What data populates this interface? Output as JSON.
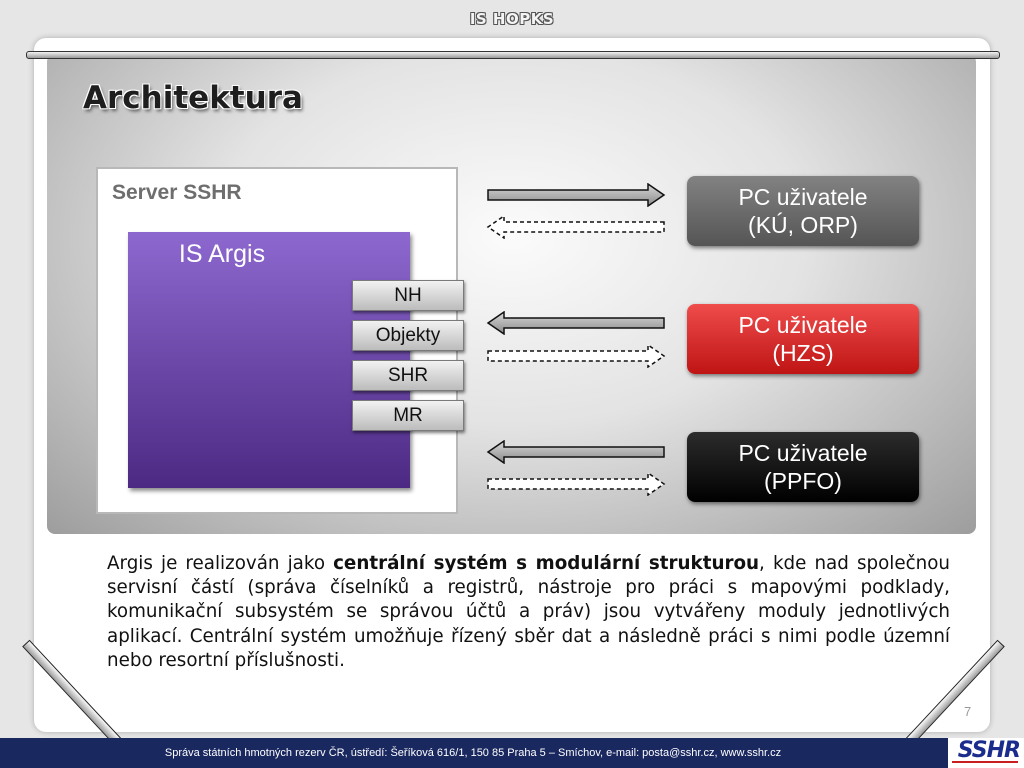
{
  "header": {
    "title": "IS HOPKS"
  },
  "slide": {
    "title": "Architektura",
    "page_number": "7"
  },
  "diagram": {
    "server_label": "Server SSHR",
    "argis_label": "IS Argis",
    "modules": [
      "NH",
      "Objekty",
      "SHR",
      "MR"
    ],
    "clients": [
      {
        "line1": "PC uživatele",
        "line2": "(KÚ, ORP)",
        "color": "#6b6b6b",
        "solid_arrow": "right"
      },
      {
        "line1": "PC uživatele",
        "line2": "(HZS)",
        "color": "#d92a2a",
        "solid_arrow": "left"
      },
      {
        "line1": "PC uživatele",
        "line2": "(PPFO)",
        "color": "#111111",
        "solid_arrow": "left"
      }
    ],
    "argis_color": "#6b46ae"
  },
  "body": {
    "pre": "Argis je realizován jako ",
    "bold": "centrální systém s modulární strukturou",
    "post": ", kde nad společnou servisní částí (správa číselníků a registrů, nástroje pro práci s mapovými podklady, komunikační subsystém se správou účtů a práv) jsou vytvářeny moduly jednotlivých aplikací. Centrální systém umožňuje řízený sběr dat a následně práci s nimi podle územní nebo resortní příslušnosti."
  },
  "footer": {
    "text": "Správa státních hmotných rezerv ČR, ústředí: Šeříková 616/1, 150 85 Praha 5 – Smíchov, e-mail: posta@sshr.cz, www.sshr.cz",
    "logo": "SSHR",
    "background": "#1a2860"
  }
}
